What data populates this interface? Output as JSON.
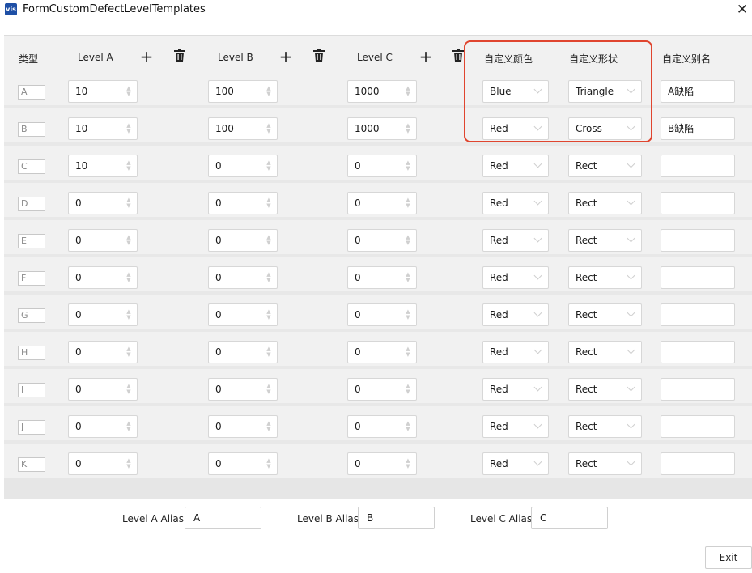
{
  "window": {
    "title": "FormCustomDefectLevelTemplates",
    "app_icon_text": "vis"
  },
  "headers": {
    "type": "类型",
    "level_a": "Level A",
    "level_b": "Level B",
    "level_c": "Level C",
    "color": "自定义颜色",
    "shape": "自定义形状",
    "alias": "自定义别名"
  },
  "icons": {
    "add": "plus-icon",
    "delete": "trash-icon",
    "close": "close-icon"
  },
  "rows": [
    {
      "type": "A",
      "level_a": "10",
      "level_b": "100",
      "level_c": "1000",
      "color": "Blue",
      "shape": "Triangle",
      "alias": "A缺陷"
    },
    {
      "type": "B",
      "level_a": "10",
      "level_b": "100",
      "level_c": "1000",
      "color": "Red",
      "shape": "Cross",
      "alias": "B缺陷"
    },
    {
      "type": "C",
      "level_a": "10",
      "level_b": "0",
      "level_c": "0",
      "color": "Red",
      "shape": "Rect",
      "alias": ""
    },
    {
      "type": "D",
      "level_a": "0",
      "level_b": "0",
      "level_c": "0",
      "color": "Red",
      "shape": "Rect",
      "alias": ""
    },
    {
      "type": "E",
      "level_a": "0",
      "level_b": "0",
      "level_c": "0",
      "color": "Red",
      "shape": "Rect",
      "alias": ""
    },
    {
      "type": "F",
      "level_a": "0",
      "level_b": "0",
      "level_c": "0",
      "color": "Red",
      "shape": "Rect",
      "alias": ""
    },
    {
      "type": "G",
      "level_a": "0",
      "level_b": "0",
      "level_c": "0",
      "color": "Red",
      "shape": "Rect",
      "alias": ""
    },
    {
      "type": "H",
      "level_a": "0",
      "level_b": "0",
      "level_c": "0",
      "color": "Red",
      "shape": "Rect",
      "alias": ""
    },
    {
      "type": "I",
      "level_a": "0",
      "level_b": "0",
      "level_c": "0",
      "color": "Red",
      "shape": "Rect",
      "alias": ""
    },
    {
      "type": "J",
      "level_a": "0",
      "level_b": "0",
      "level_c": "0",
      "color": "Red",
      "shape": "Rect",
      "alias": ""
    },
    {
      "type": "K",
      "level_a": "0",
      "level_b": "0",
      "level_c": "0",
      "color": "Red",
      "shape": "Rect",
      "alias": ""
    }
  ],
  "footer": {
    "level_a_alias_label": "Level A Alias:",
    "level_a_alias": "A",
    "level_b_alias_label": "Level B Alias:",
    "level_b_alias": "B",
    "level_c_alias_label": "Level C Alias:",
    "level_c_alias": "C",
    "exit_label": "Exit"
  },
  "colors": {
    "highlight": "#e0452f",
    "app_icon": "#1e4fa5"
  }
}
